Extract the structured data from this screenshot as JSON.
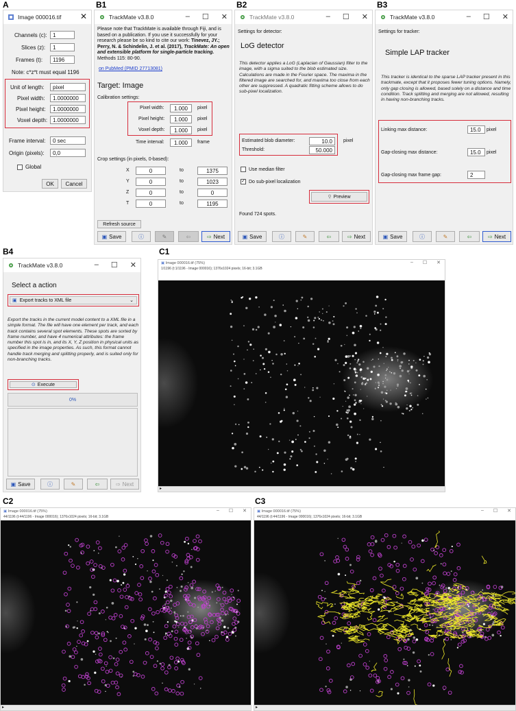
{
  "panel_labels": {
    "a": "A",
    "b1": "B1",
    "b2": "B2",
    "b3": "B3",
    "b4": "B4",
    "c1": "C1",
    "c2": "C2",
    "c3": "C3"
  },
  "panelA": {
    "title": "Image 000016.tif",
    "channels_label": "Channels (c):",
    "channels": "1",
    "slices_label": "Slices (z):",
    "slices": "1",
    "frames_label": "Frames (t):",
    "frames": "1196",
    "note": "Note: c*z*t must equal 1196",
    "unit_label": "Unit of length:",
    "unit": "pixel",
    "pw_label": "Pixel width:",
    "pw": "1.0000000",
    "ph_label": "Pixel height:",
    "ph": "1.0000000",
    "vd_label": "Voxel depth:",
    "vd": "1.0000000",
    "fi_label": "Frame interval:",
    "fi": "0 sec",
    "origin_label": "Origin (pixels):",
    "origin": "0,0",
    "global_label": "Global",
    "ok": "OK",
    "cancel": "Cancel"
  },
  "tm_title": "TrackMate v3.8.0",
  "buttons": {
    "save": "Save",
    "next": "Next"
  },
  "panelB1": {
    "intro_plain": "Please note that TrackMate is available through Fiji, and is based on a publication. If you use it successfully for your research please be so kind to cite our work:",
    "authors": "Tinevez, JY.; Perry, N. & Schindelin, J. et al. (2017),",
    "paper_title": "TrackMate: An open and extensible platform for single-particle tracking.",
    "journal": "Methods 115: 80-90.",
    "pubmed": "on PubMed (PMID 27713081)",
    "target": "Target: Image",
    "calib": "Calibration settings:",
    "pw_label": "Pixel width:",
    "pw": "1.000",
    "pw_unit": "pixel",
    "ph_label": "Pixel height:",
    "ph": "1.000",
    "ph_unit": "pixel",
    "vd_label": "Voxel depth:",
    "vd": "1.000",
    "vd_unit": "pixel",
    "ti_label": "Time interval:",
    "ti": "1.000",
    "ti_unit": "frame",
    "crop": "Crop settings (in pixels, 0-based):",
    "crop_rows": [
      {
        "axis": "X",
        "from": "0",
        "to_label": "to",
        "to": "1375"
      },
      {
        "axis": "Y",
        "from": "0",
        "to_label": "to",
        "to": "1023"
      },
      {
        "axis": "Z",
        "from": "0",
        "to_label": "to",
        "to": "0"
      },
      {
        "axis": "T",
        "from": "0",
        "to_label": "to",
        "to": "1195"
      }
    ],
    "refresh": "Refresh source"
  },
  "panelB2": {
    "header": "Settings for detector:",
    "name": "LoG detector",
    "desc": "This detector applies a LoG (Laplacian of Gaussian) filter to the image, with a sigma suited to the blob estimated size. Calculations are made in the Fourier space. The maxima in the filtered image are searched for, and maxima too close from each other are suppressed. A quadratic fitting scheme allows to do sub-pixel localization.",
    "diam_label": "Estimated blob diameter:",
    "diam": "10.0",
    "diam_unit": "pixel",
    "thr_label": "Threshold:",
    "thr": "50.000",
    "median": "Use median filter",
    "subpixel": "Do sub-pixel localization",
    "preview": "Preview",
    "found": "Found 724 spots."
  },
  "panelB3": {
    "header": "Settings for tracker:",
    "name": "Simple LAP tracker",
    "desc": "This tracker is identical to the sparse LAP tracker present in this trackmate, except that it proposes fewer tuning options. Namely, only gap closing is allowed, based solely on a distance and time condition. Track splitting and merging are not allowed, resulting in having non-branching tracks.",
    "link_label": "Linking max distance:",
    "link": "15.0",
    "link_unit": "pixel",
    "gap_label": "Gap-closing max distance:",
    "gap": "15.0",
    "gap_unit": "pixel",
    "frame_label": "Gap-closing max frame gap:",
    "frame": "2"
  },
  "panelB4": {
    "select": "Select a action",
    "option": "Export tracks to XML file",
    "desc": "Export the tracks in the current model content to a XML file in a simple format. The file will have one element per track, and each track contains several spot elements. These spots are sorted by frame number, and have 4 numerical attributes: the frame number this spot is in, and its X, Y, Z position in physical units as specified in the image properties. As such, this format cannot handle track merging and splitting properly, and is suited only for non-branching tracks.",
    "execute": "Execute",
    "progress": "0%"
  },
  "panelC1": {
    "title": "Image 000016.tif (75%)",
    "info": "1/1196 (t:1/1196 - Image 000016); 1376x1024 pixels; 16-bit; 3.1GB"
  },
  "panelC2": {
    "title": "Image 000016.tif (75%)",
    "info": "44/1196 (t:44/1196 - Image 000016); 1376x1024 pixels; 16-bit; 3.1GB"
  },
  "panelC3": {
    "title": "Image 000016.tif (75%)",
    "info": "44/1196 (t:44/1196 - Image 000016); 1376x1024 pixels; 16-bit; 3.1GB"
  }
}
